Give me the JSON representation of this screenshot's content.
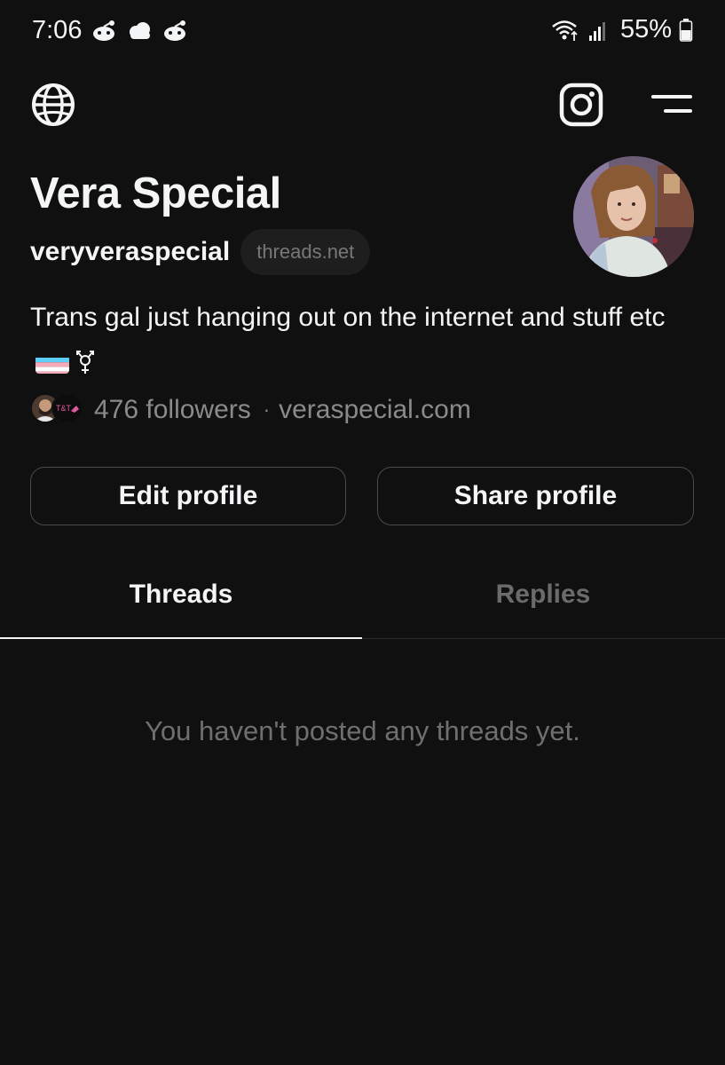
{
  "status_bar": {
    "time": "7:06",
    "battery": "55%",
    "notification_icons": [
      "reddit-icon",
      "cloud-icon",
      "reddit-icon"
    ]
  },
  "nav": {
    "globe_icon": "globe-icon",
    "instagram_icon": "instagram-icon",
    "menu_icon": "menu-icon"
  },
  "profile": {
    "name": "Vera Special",
    "handle": "veryveraspecial",
    "domain_chip": "threads.net",
    "bio_text": "Trans gal just hanging out on the internet and stuff etc",
    "bio_emojis": [
      "transgender-flag",
      "transgender-symbol"
    ],
    "followers": "476 followers",
    "separator": "·",
    "website": "veraspecial.com"
  },
  "buttons": {
    "edit": "Edit profile",
    "share": "Share profile"
  },
  "tabs": [
    {
      "label": "Threads",
      "active": true
    },
    {
      "label": "Replies",
      "active": false
    }
  ],
  "empty_state": "You haven't posted any threads yet.",
  "colors": {
    "background": "#101010",
    "text": "#f3f5f7",
    "muted": "#8a8a8a",
    "inactive_tab": "#6b6b6b",
    "button_border": "#4a4a4a",
    "chip_background": "#1e1e1e"
  }
}
